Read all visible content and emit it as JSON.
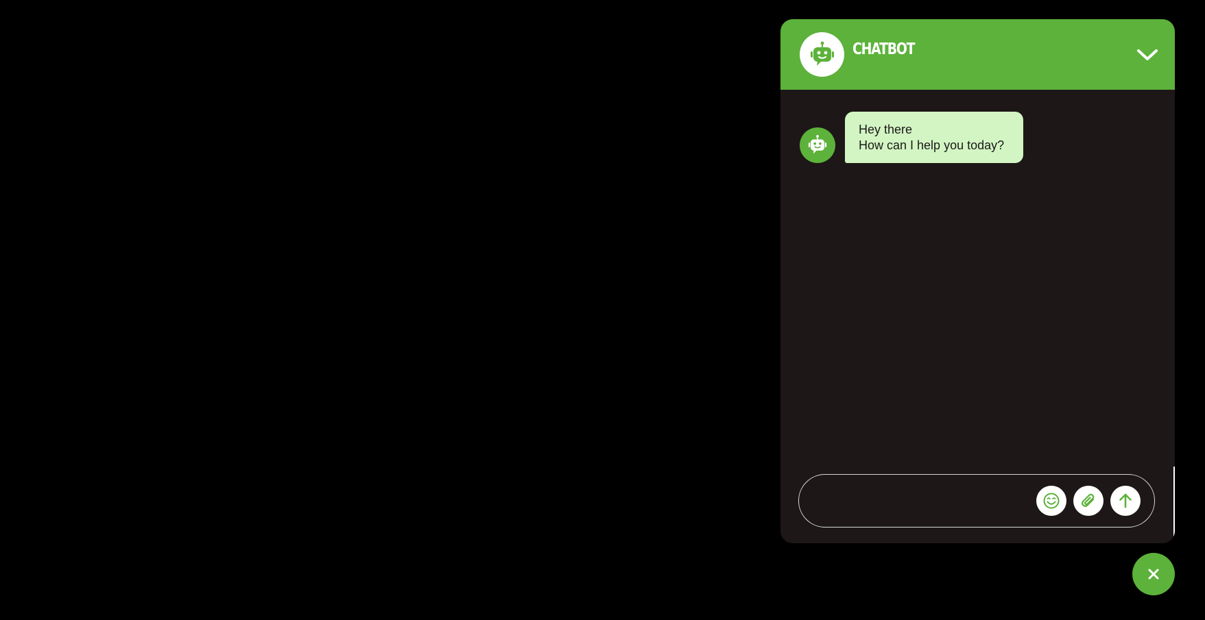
{
  "colors": {
    "accent": "#5cb23a",
    "panel_background": "#1d1718",
    "bot_bubble": "#d3f5c3",
    "page_background": "#000000"
  },
  "header": {
    "title": "CHATBOT",
    "avatar_icon": "robot-icon",
    "collapse_icon": "chevron-down-icon"
  },
  "messages": [
    {
      "sender": "bot",
      "avatar_icon": "robot-icon",
      "lines": [
        "Hey there",
        "How can I help you today?"
      ]
    }
  ],
  "composer": {
    "value": "",
    "emoji_icon": "smiley-icon",
    "attach_icon": "paperclip-icon",
    "send_icon": "arrow-up-icon"
  },
  "launcher": {
    "icon": "close-icon"
  }
}
